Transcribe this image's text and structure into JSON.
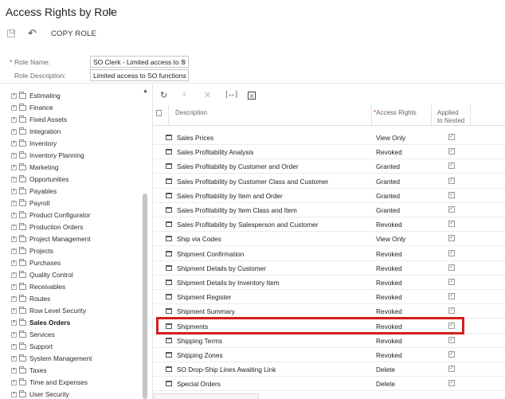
{
  "header": {
    "title": "Access Rights by Role",
    "star_icon": "star-icon"
  },
  "toolbar": {
    "copy_role_label": "COPY ROLE"
  },
  "form": {
    "role_name_label": "Role Name:",
    "role_name_required": "*",
    "role_name_value": "SO Clerk - Limited access to S",
    "role_description_label": "Role Description:",
    "role_description_value": "Limited access to SO functions"
  },
  "tree": {
    "items": [
      {
        "label": "Estimating",
        "bold": false
      },
      {
        "label": "Finance",
        "bold": false
      },
      {
        "label": "Fixed Assets",
        "bold": false
      },
      {
        "label": "Integration",
        "bold": false
      },
      {
        "label": "Inventory",
        "bold": false
      },
      {
        "label": "Inventory Planning",
        "bold": false
      },
      {
        "label": "Marketing",
        "bold": false
      },
      {
        "label": "Opportunities",
        "bold": false
      },
      {
        "label": "Payables",
        "bold": false
      },
      {
        "label": "Payroll",
        "bold": false
      },
      {
        "label": "Product Configurator",
        "bold": false
      },
      {
        "label": "Production Orders",
        "bold": false
      },
      {
        "label": "Project Management",
        "bold": false
      },
      {
        "label": "Projects",
        "bold": false
      },
      {
        "label": "Purchases",
        "bold": false
      },
      {
        "label": "Quality Control",
        "bold": false
      },
      {
        "label": "Receivables",
        "bold": false
      },
      {
        "label": "Routes",
        "bold": false
      },
      {
        "label": "Row Level Security",
        "bold": false
      },
      {
        "label": "Sales Orders",
        "bold": true
      },
      {
        "label": "Services",
        "bold": false
      },
      {
        "label": "Support",
        "bold": false
      },
      {
        "label": "System Management",
        "bold": false
      },
      {
        "label": "Taxes",
        "bold": false
      },
      {
        "label": "Time and Expenses",
        "bold": false
      },
      {
        "label": "User Security",
        "bold": false
      }
    ]
  },
  "grid": {
    "columns": {
      "description": "Description",
      "access_rights_required": "*",
      "access_rights": "Access Rights",
      "applied_line1": "Applied",
      "applied_line2": "to Nested"
    },
    "rows": [
      {
        "description": "Sales Prices",
        "rights": "View Only",
        "applied": true
      },
      {
        "description": "Sales Profitability Analysis",
        "rights": "Revoked",
        "applied": true
      },
      {
        "description": "Sales Profitability by Customer and Order",
        "rights": "Granted",
        "applied": true
      },
      {
        "description": "Sales Profitability by Customer Class and Customer",
        "rights": "Granted",
        "applied": true
      },
      {
        "description": "Sales Profitability by Item and Order",
        "rights": "Granted",
        "applied": true
      },
      {
        "description": "Sales Profitability by Item Class and Item",
        "rights": "Granted",
        "applied": true
      },
      {
        "description": "Sales Profitability by Salesperson and Customer",
        "rights": "Revoked",
        "applied": true
      },
      {
        "description": "Ship via Codes",
        "rights": "View Only",
        "applied": true
      },
      {
        "description": "Shipment Confirmation",
        "rights": "Revoked",
        "applied": true
      },
      {
        "description": "Shipment Details by Customer",
        "rights": "Revoked",
        "applied": true
      },
      {
        "description": "Shipment Details by Inventory Item",
        "rights": "Revoked",
        "applied": true
      },
      {
        "description": "Shipment Register",
        "rights": "Revoked",
        "applied": true
      },
      {
        "description": "Shipment Summary",
        "rights": "Revoked",
        "applied": true
      },
      {
        "description": "Shipments",
        "rights": "Revoked",
        "applied": true
      },
      {
        "description": "Shipping Terms",
        "rights": "Revoked",
        "applied": true
      },
      {
        "description": "Shipping Zones",
        "rights": "Revoked",
        "applied": true
      },
      {
        "description": "SO Drop-Ship Lines Awaiting Link",
        "rights": "Delete",
        "applied": true
      },
      {
        "description": "Special Orders",
        "rights": "Delete",
        "applied": true
      }
    ],
    "highlighted_row": "Shipments"
  },
  "colors": {
    "highlight": "#d21e1e"
  }
}
